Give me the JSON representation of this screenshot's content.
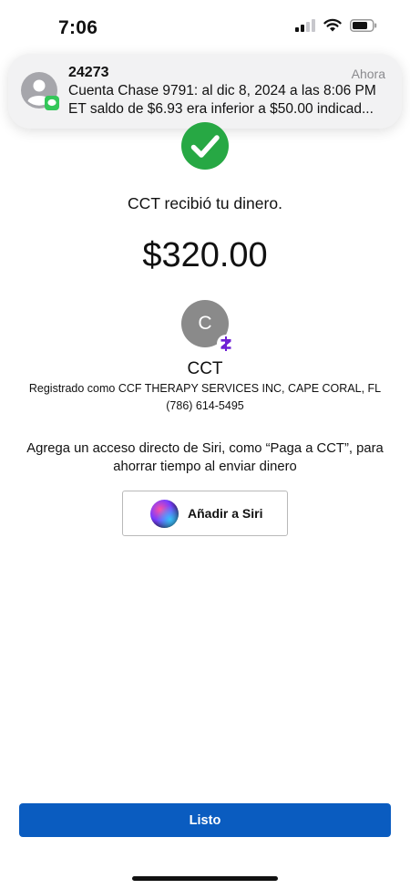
{
  "status_bar": {
    "time": "7:06"
  },
  "notification": {
    "sender": "24273",
    "time": "Ahora",
    "line1": "Cuenta Chase 9791: al dic 8, 2024 a las 8:06 PM",
    "line2": "ET saldo de $6.93 era inferior a $50.00 indicad...",
    "app_badge_color": "#34c759"
  },
  "confirmation": {
    "message": "CCT recibió tu dinero.",
    "amount": "$320.00",
    "check_color": "#27a844"
  },
  "recipient": {
    "initial": "C",
    "name": "CCT",
    "registered_as": "Registrado como CCF THERAPY SERVICES INC, CAPE CORAL, FL",
    "phone": "(786) 614-5495",
    "badge_icon": "zelle-icon",
    "badge_color": "#6d1ed4"
  },
  "siri": {
    "hint": "Agrega un acceso directo de Siri, como “Paga a CCT”, para ahorrar tiempo al enviar dinero",
    "button_label": "Añadir a Siri"
  },
  "footer": {
    "done_label": "Listo",
    "accent_color": "#0a5cc0"
  }
}
